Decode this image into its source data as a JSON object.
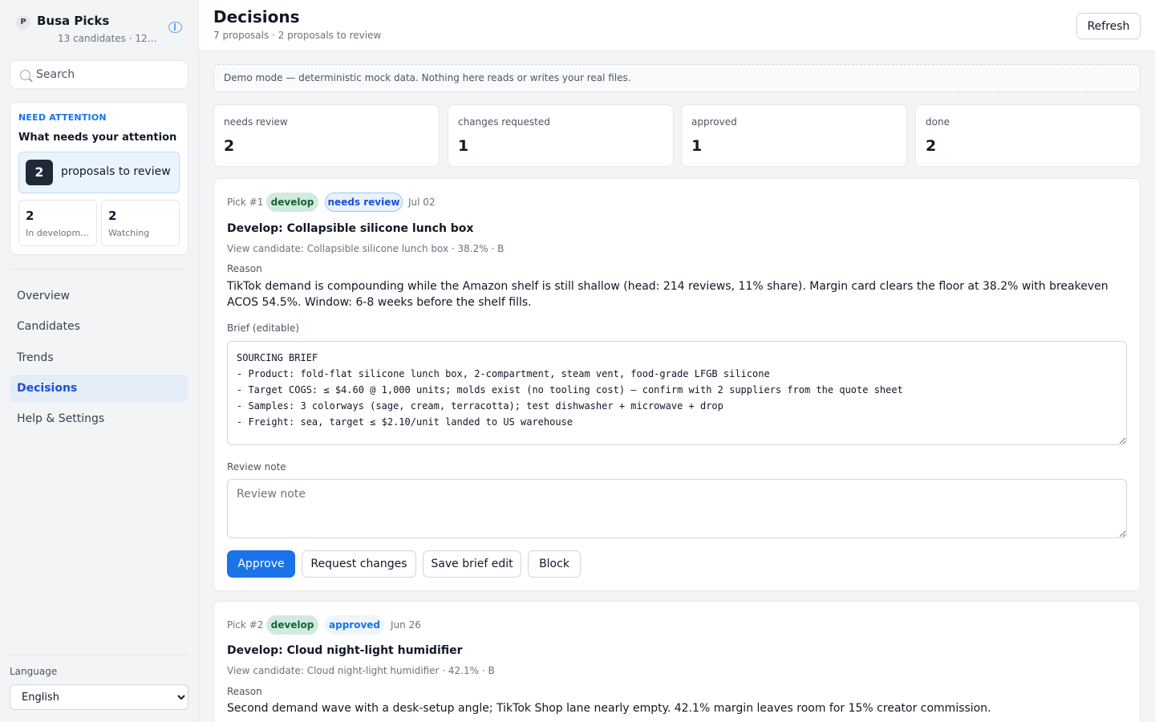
{
  "brand": {
    "initial": "P",
    "name": "Busa Picks",
    "subtitle": "13 candidates · 12 trends"
  },
  "search": {
    "placeholder": "Search"
  },
  "attention": {
    "eyebrow": "NEED ATTENTION",
    "title": "What needs your attention",
    "primary": {
      "count": "2",
      "label": "proposals to review"
    },
    "items": [
      {
        "count": "2",
        "label": "In development"
      },
      {
        "count": "2",
        "label": "Watching"
      }
    ]
  },
  "nav": {
    "items": [
      {
        "label": "Overview"
      },
      {
        "label": "Candidates"
      },
      {
        "label": "Trends"
      },
      {
        "label": "Decisions"
      },
      {
        "label": "Help & Settings"
      }
    ],
    "active": "Decisions"
  },
  "language": {
    "label": "Language",
    "selected": "English"
  },
  "header": {
    "title": "Decisions",
    "subtitle": "7 proposals · 2 proposals to review",
    "refresh_label": "Refresh"
  },
  "demo_banner": "Demo mode — deterministic mock data. Nothing here reads or writes your real files.",
  "stats": [
    {
      "label": "needs review",
      "value": "2"
    },
    {
      "label": "changes requested",
      "value": "1"
    },
    {
      "label": "approved",
      "value": "1"
    },
    {
      "label": "done",
      "value": "2"
    }
  ],
  "proposals": [
    {
      "pick": "Pick #1",
      "type_badge": "develop",
      "status_badge": "needs review",
      "date": "Jul 02",
      "title": "Develop: Collapsible silicone lunch box",
      "view_link": "View candidate: Collapsible silicone lunch box · 38.2% · B",
      "reason_label": "Reason",
      "reason": "TikTok demand is compounding while the Amazon shelf is still shallow (head: 214 reviews, 11% share). Margin card clears the floor at 38.2% with breakeven ACOS 54.5%. Window: 6-8 weeks before the shelf fills.",
      "brief_label": "Brief (editable)",
      "brief": "SOURCING BRIEF\n- Product: fold-flat silicone lunch box, 2-compartment, steam vent, food-grade LFGB silicone\n- Target COGS: ≤ $4.60 @ 1,000 units; molds exist (no tooling cost) — confirm with 2 suppliers from the quote sheet\n- Samples: 3 colorways (sage, cream, terracotta); test dishwasher + microwave + drop\n- Freight: sea, target ≤ $2.10/unit landed to US warehouse",
      "note_label": "Review note",
      "note_placeholder": "Review note",
      "actions": {
        "approve": "Approve",
        "request_changes": "Request changes",
        "save_brief": "Save brief edit",
        "block": "Block"
      }
    },
    {
      "pick": "Pick #2",
      "type_badge": "develop",
      "status_badge": "approved",
      "date": "Jun 26",
      "title": "Develop: Cloud night-light humidifier",
      "view_link": "View candidate: Cloud night-light humidifier · 42.1% · B",
      "reason_label": "Reason",
      "reason": "Second demand wave with a desk-setup angle; TikTok Shop lane nearly empty. 42.1% margin leaves room for 15% creator commission."
    }
  ]
}
